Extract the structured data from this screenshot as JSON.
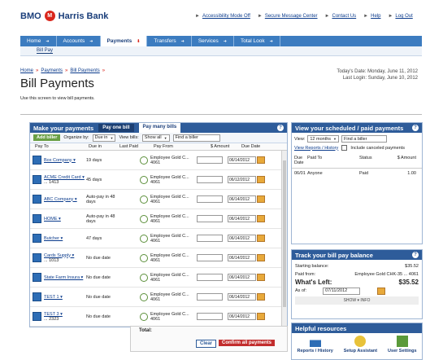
{
  "brand": {
    "name": "BMO",
    "sub": "Harris Bank",
    "roundel": "M"
  },
  "toplinks": [
    "Accessibility Mode Off",
    "Secure Message Center",
    "Contact Us",
    "Help",
    "Log Out"
  ],
  "nav": [
    {
      "label": "Home"
    },
    {
      "label": "Accounts"
    },
    {
      "label": "Payments"
    },
    {
      "label": "Transfers"
    },
    {
      "label": "Services"
    },
    {
      "label": "Total Look"
    }
  ],
  "subnav": "Bill Pay",
  "breadcrumb": [
    "Home",
    "Payments",
    "Bill Payments"
  ],
  "page_title": "Bill Payments",
  "page_desc": "Use this screen to view bill payments.",
  "dates": {
    "today": "Today's Date: Monday, June 11, 2012",
    "last_login": "Last Login: Sunday, June 10, 2012"
  },
  "make": {
    "title": "Make your payments",
    "tabs": [
      "Pay one bill",
      "Pay many bills"
    ],
    "add_biller": "Add biller",
    "organize_label": "Organize by:",
    "organize_value": "Due in",
    "view_label": "View bills:",
    "view_value": "Show all",
    "find_placeholder": "Find a biller",
    "cols": [
      "Pay To",
      "Due in",
      "Last Paid",
      "Pay From",
      "$ Amount",
      "Due Date"
    ],
    "rows": [
      {
        "name": "Box Company ▾",
        "sub": "",
        "due": "19 days",
        "from": "Employee Gold C... 4061",
        "date": "06/14/2012"
      },
      {
        "name": "ACME Credit Card ▾",
        "sub": "... 1413",
        "due": "45 days",
        "from": "Employee Gold C... 4061",
        "date": "06/12/2012"
      },
      {
        "name": "ABC Company ▾",
        "sub": "",
        "due": "Auto-pay in 48 days",
        "from": "Employee Gold C... 4061",
        "date": "06/14/2012"
      },
      {
        "name": "HOME ▾",
        "sub": "",
        "due": "Auto-pay in 48 days",
        "from": "Employee Gold C... 4061",
        "date": "06/14/2012"
      },
      {
        "name": "Butcher ▾",
        "sub": "",
        "due": "47 days",
        "from": "Employee Gold C... 4061",
        "date": "06/14/2012"
      },
      {
        "name": "Cards Supply ▾",
        "sub": "... 1013",
        "due": "No due date",
        "from": "Employee Gold C... 4061",
        "date": "06/14/2012"
      },
      {
        "name": "State Farm Insura ▾",
        "sub": "",
        "due": "No due date",
        "from": "Employee Gold C... 4061",
        "date": "06/14/2012"
      },
      {
        "name": "TEST 1 ▾",
        "sub": "",
        "due": "No due date",
        "from": "Employee Gold C... 4061",
        "date": "06/14/2012"
      },
      {
        "name": "TEST 3 ▾",
        "sub": "... 2323",
        "due": "No due date",
        "from": "Employee Gold C... 4061",
        "date": "06/14/2012"
      }
    ],
    "total_label": "Total:",
    "clear": "Clear",
    "confirm": "Confirm all payments"
  },
  "scheduled": {
    "title": "View your scheduled / paid payments",
    "view_label": "View:",
    "view_value": "12 months",
    "find_placeholder": "Find a biller",
    "history_link": "View Reports / History",
    "include_label": "Include canceled payments",
    "cols": [
      "Due Date",
      "Paid To",
      "Status",
      "$ Amount"
    ],
    "rows": [
      {
        "date": "06/01",
        "to": "Anyone",
        "status": "Paid",
        "amount": "1.00"
      }
    ]
  },
  "track": {
    "title": "Track your bill pay balance",
    "starting_label": "Starting balance:",
    "starting_value": "$35.52",
    "paid_from_label": "Paid from:",
    "paid_from_value": "Employee Gold CHK-35 ... 4061",
    "left_label": "What's Left:",
    "left_value": "$35.52",
    "asof_label": "As of:",
    "asof_value": "07/11/2012",
    "show_info": "SHOW ▾ INFO"
  },
  "resources": {
    "title": "Helpful resources",
    "items": [
      "Reports / History",
      "Setup Assistant",
      "User Settings"
    ]
  },
  "colors": {
    "primary": "#2e5c9a",
    "nav": "#3c7cc0",
    "accent": "#d9261c"
  }
}
